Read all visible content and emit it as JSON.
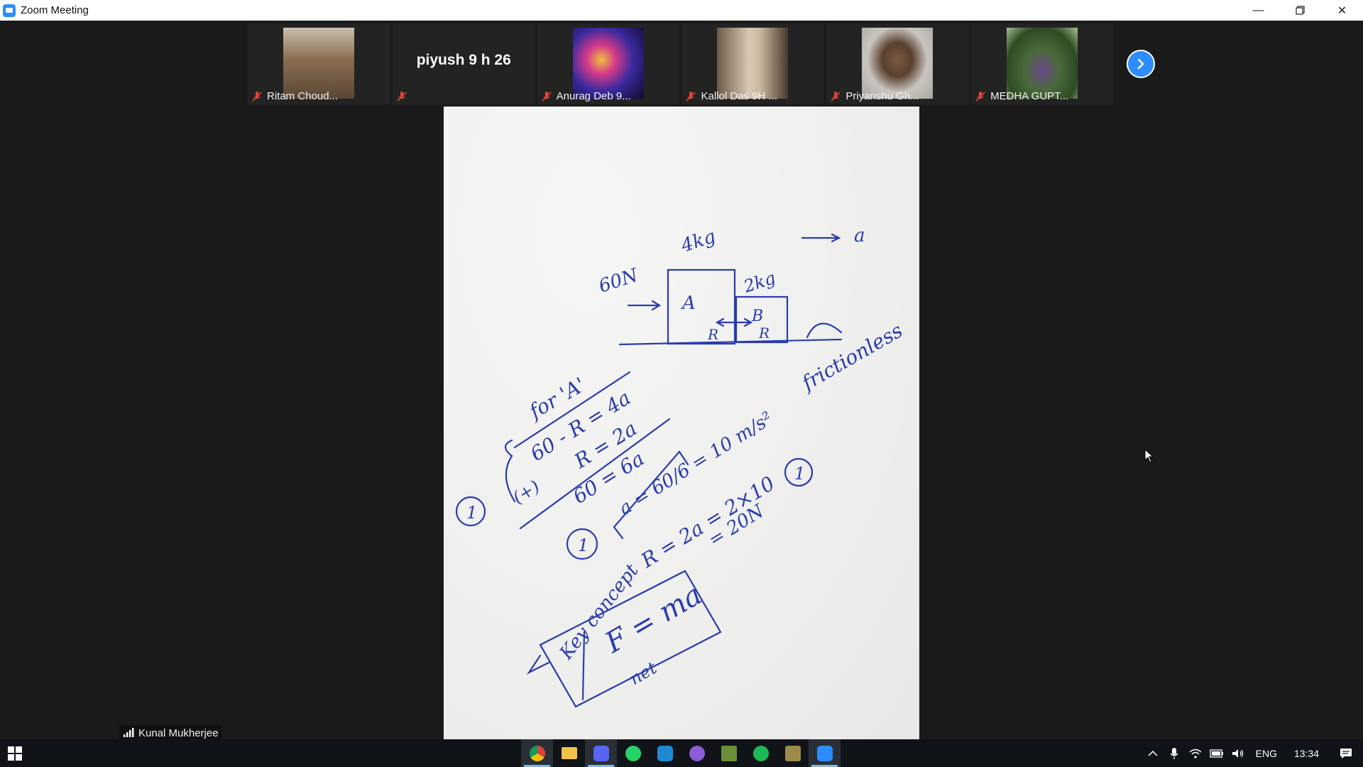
{
  "window": {
    "title": "Zoom Meeting",
    "controls": [
      "minimize",
      "restore",
      "close"
    ]
  },
  "participants": [
    {
      "name": "Ritam Choud...",
      "muted": true,
      "has_video": true,
      "thumb_color": "#7a6a52"
    },
    {
      "name": "piyush 9 h 26",
      "muted": true,
      "has_video": false
    },
    {
      "name": "Anurag Deb 9...",
      "muted": true,
      "has_video": true,
      "thumb_color": "#3a2a6e"
    },
    {
      "name": "Kallol Das 9H ...",
      "muted": true,
      "has_video": true,
      "thumb_color": "#b9a58e"
    },
    {
      "name": "Priyanshu Gh...",
      "muted": true,
      "has_video": true,
      "thumb_color": "#8d8a84"
    },
    {
      "name": "MEDHA GUPT...",
      "muted": true,
      "has_video": true,
      "thumb_color": "#4f6b3a"
    }
  ],
  "next_page_icon": "chevron-right-icon",
  "shared_content": {
    "labels": {
      "force": "60N",
      "mass_a": "4kg",
      "mass_b": "2kg",
      "accel": "a",
      "block_a": "A",
      "block_b": "B",
      "reaction": "R",
      "surface": "frictionless"
    },
    "equations": [
      "for 'A'",
      "60 - R = 4a",
      "R = 2a",
      "(+)",
      "60 = 6a",
      "a = 60/6 = 10 m/s²",
      "R = 2a = 2×10",
      "= 20N",
      "Key concept",
      "F = ma",
      "net"
    ],
    "marks": [
      "1",
      "1",
      "1"
    ]
  },
  "active_speaker": "Kunal Mukherjee",
  "taskbar": {
    "apps": [
      "chrome-icon",
      "file-explorer-icon",
      "discord-icon",
      "whatsapp-icon",
      "vscode-icon",
      "app-icon",
      "minecraft-icon",
      "spotify-icon",
      "game-icon",
      "zoom-icon"
    ],
    "language": "ENG",
    "time": "13:34"
  },
  "colors": {
    "zoom_blue": "#2d8cff",
    "ink": "#2a3bb0",
    "taskbar": "#101318"
  }
}
